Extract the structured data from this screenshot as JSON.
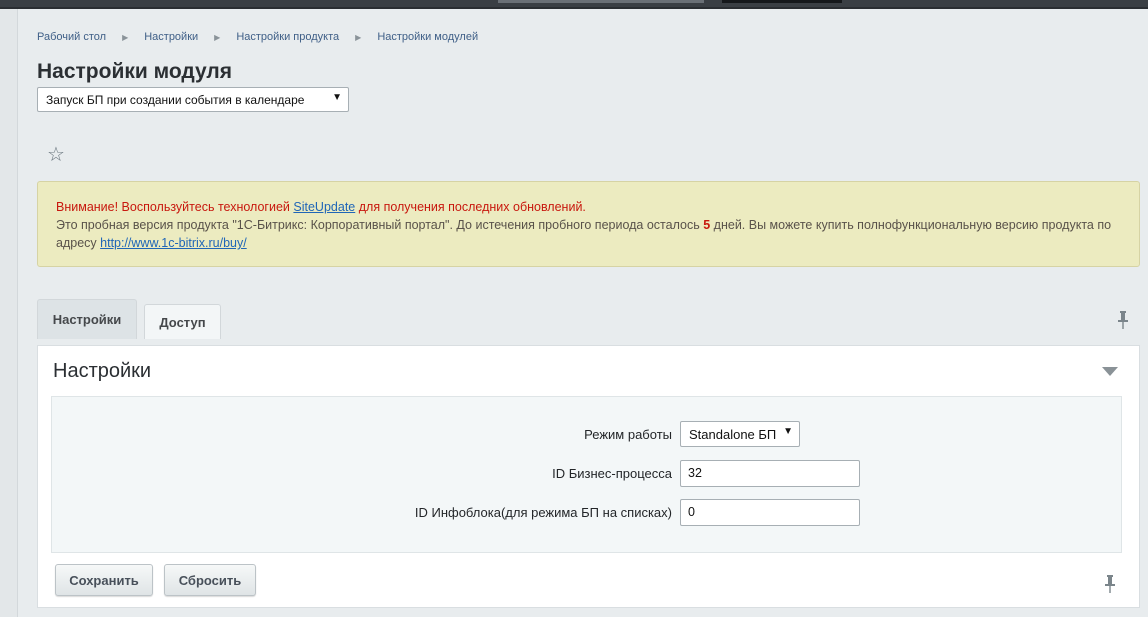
{
  "breadcrumb": [
    "Рабочий стол",
    "Настройки",
    "Настройки продукта",
    "Настройки модулей"
  ],
  "page": {
    "title": "Настройки модуля",
    "module_select": "Запуск БП при создании события в календаре"
  },
  "notice": {
    "warning_prefix": "Внимание! Воспользуйтесь технологией",
    "siteupdate_link": "SiteUpdate",
    "warning_suffix": "для получения последних обновлений.",
    "trial_text": "Это пробная версия продукта \"1С-Битрикс: Корпоративный портал\". До истечения пробного периода осталось",
    "days": "5",
    "trial_text2": "дней. Вы можете купить полнофункциональную версию продукта по адресу",
    "buy_link": "http://www.1c-bitrix.ru/buy/"
  },
  "tabs": [
    {
      "label": "Настройки",
      "active": true
    },
    {
      "label": "Доступ",
      "active": false
    }
  ],
  "panel": {
    "title": "Настройки",
    "fields": {
      "mode_label": "Режим работы",
      "mode_value": "Standalone БП",
      "bp_id_label": "ID Бизнес-процесса",
      "bp_id_value": "32",
      "iblock_id_label": "ID Инфоблока(для режима БП на списках)",
      "iblock_id_value": "0"
    }
  },
  "buttons": {
    "save": "Сохранить",
    "reset": "Сбросить"
  },
  "icons": {
    "favorite": "star-icon",
    "pin": "pin-icon",
    "collapse": "collapse-triangle-icon",
    "dropdown": "dropdown-arrow-icon"
  },
  "colors": {
    "warning": "#c8180e",
    "link": "#2066b7",
    "notice_bg": "#ecebc0",
    "page_bg": "#e8ecee"
  }
}
